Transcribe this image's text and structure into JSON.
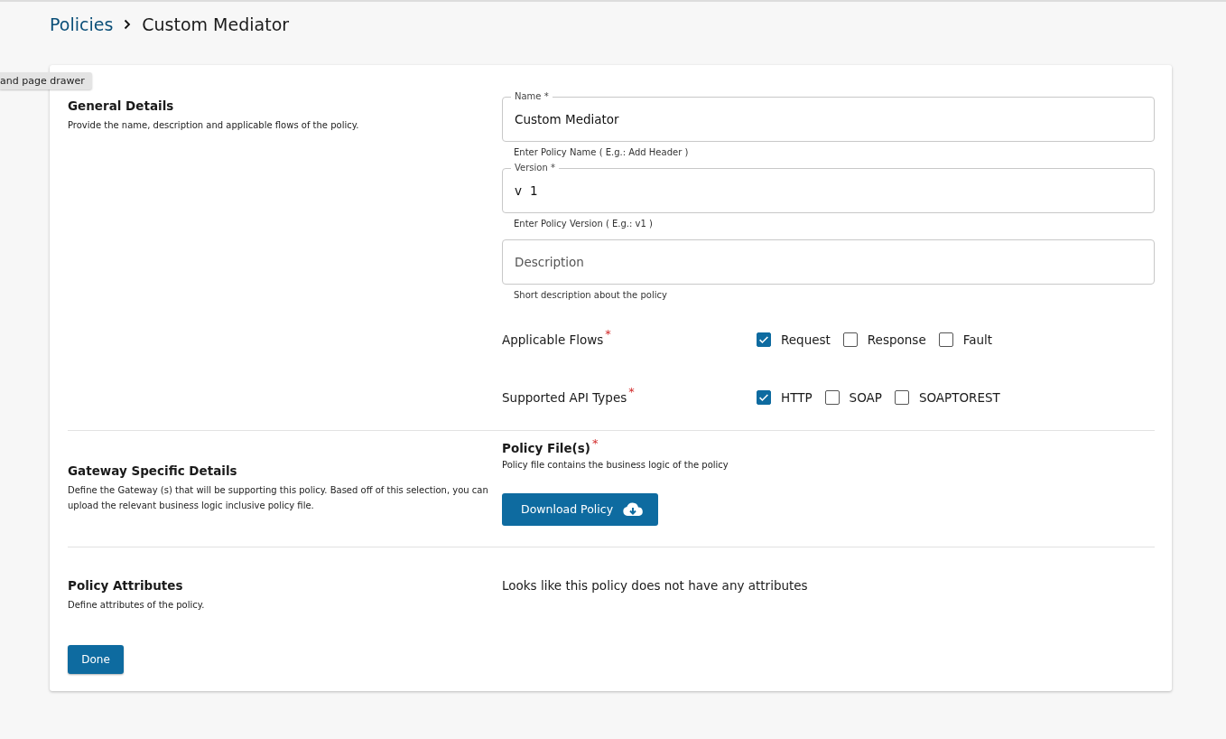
{
  "breadcrumb": {
    "parent": "Policies",
    "current": "Custom Mediator"
  },
  "tooltip": "and page drawer",
  "general": {
    "title": "General Details",
    "description": "Provide the name, description and applicable flows of the policy.",
    "fields": [
      {
        "label": "Name",
        "required_mark": "*",
        "value": "Custom Mediator",
        "helper": "Enter Policy Name ( E.g.: Add Header )"
      },
      {
        "label": "Version",
        "required_mark": "*",
        "prefix": "v",
        "value": "1",
        "helper": "Enter Policy Version ( E.g.: v1 )"
      },
      {
        "placeholder": "Description",
        "helper": "Short description about the policy"
      }
    ],
    "check_groups": [
      {
        "label": "Applicable Flows",
        "required_mark": "*",
        "options": [
          {
            "label": "Request",
            "checked": true
          },
          {
            "label": "Response",
            "checked": false
          },
          {
            "label": "Fault",
            "checked": false
          }
        ]
      },
      {
        "label": "Supported API Types",
        "required_mark": "*",
        "options": [
          {
            "label": "HTTP",
            "checked": true
          },
          {
            "label": "SOAP",
            "checked": false
          },
          {
            "label": "SOAPTOREST",
            "checked": false
          }
        ]
      }
    ]
  },
  "gateway": {
    "title": "Gateway Specific Details",
    "description": "Define the Gateway (s) that will be supporting this policy. Based off of this selection, you can upload the relevant business logic inclusive policy file.",
    "files_title": "Policy File(s)",
    "files_required_mark": "*",
    "files_description": "Policy file contains the business logic of the policy",
    "download_button": "Download Policy"
  },
  "attributes": {
    "title": "Policy Attributes",
    "description": "Define attributes of the policy.",
    "empty_message": "Looks like this policy does not have any attributes"
  },
  "done_button": "Done"
}
